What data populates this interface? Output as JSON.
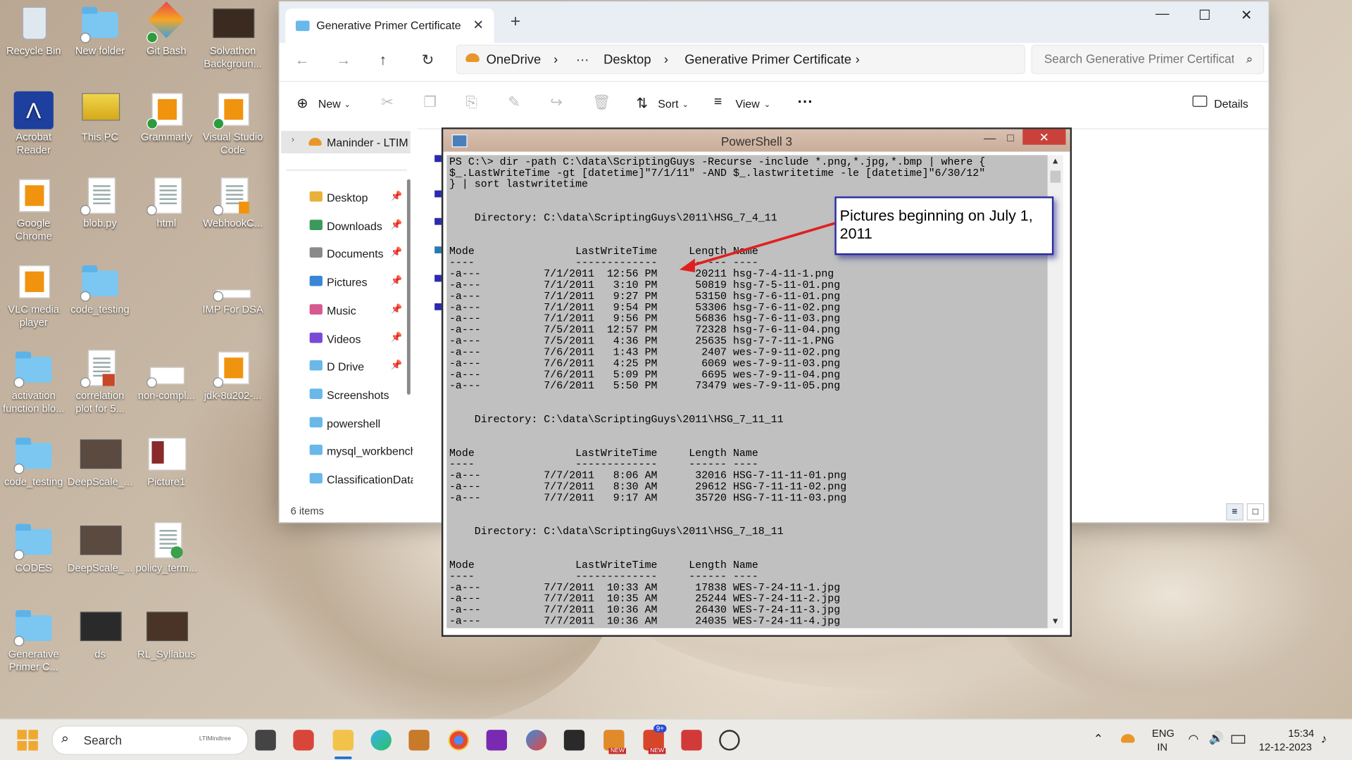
{
  "desktop_icons": [
    {
      "label": "Recycle Bin"
    },
    {
      "label": "New folder"
    },
    {
      "label": "Git Bash"
    },
    {
      "label": "Solvathon Backgroun..."
    },
    {
      "label": "Acrobat Reader"
    },
    {
      "label": "This PC"
    },
    {
      "label": "Grammarly"
    },
    {
      "label": "Visual Studio Code"
    },
    {
      "label": "Google Chrome"
    },
    {
      "label": "blob.py"
    },
    {
      "label": "html"
    },
    {
      "label": "WebhookC..."
    },
    {
      "label": "VLC media player"
    },
    {
      "label": "code_testing"
    },
    {
      "label": "IMP For DSA"
    },
    {
      "label": "activation function blo..."
    },
    {
      "label": "correlation plot for 5..."
    },
    {
      "label": "non-compl..."
    },
    {
      "label": "jdk-8u202-..."
    },
    {
      "label": "code_testing"
    },
    {
      "label": "DeepScale_..."
    },
    {
      "label": "Picture1"
    },
    {
      "label": "CODES"
    },
    {
      "label": "DeepScale_..."
    },
    {
      "label": "policy_term..."
    },
    {
      "label": "Generative Primer C..."
    },
    {
      "label": "ds"
    },
    {
      "label": "RL_Syllabus"
    }
  ],
  "explorer": {
    "tab_title": "Generative Primer Certificate",
    "new_tab_symbol": "+",
    "close_tab_symbol": "✕",
    "window_controls": {
      "minimize": "—",
      "maximize": "☐",
      "close": "✕"
    },
    "breadcrumb": [
      "OneDrive",
      "Desktop",
      "Generative Primer Certificate"
    ],
    "breadcrumb_sep": "›",
    "overflow": "···",
    "search_placeholder": "Search Generative Primer Certificate",
    "toolbar": {
      "new": "New",
      "sort": "Sort",
      "view": "View",
      "more": "···",
      "details": "Details"
    },
    "sidebar_root": "Maninder - LTIM",
    "nav_items": [
      {
        "label": "Desktop",
        "icon": "desktop-icon",
        "color": "#e8b23a",
        "pinned": true
      },
      {
        "label": "Downloads",
        "icon": "download-icon",
        "color": "#3a9a5b",
        "pinned": true
      },
      {
        "label": "Documents",
        "icon": "document-icon",
        "color": "#8a8a8a",
        "pinned": true
      },
      {
        "label": "Pictures",
        "icon": "picture-icon",
        "color": "#3a86d6",
        "pinned": true
      },
      {
        "label": "Music",
        "icon": "music-icon",
        "color": "#d65a8f",
        "pinned": true
      },
      {
        "label": "Videos",
        "icon": "video-icon",
        "color": "#7a4ad6",
        "pinned": true
      },
      {
        "label": "D Drive",
        "icon": "folder-icon",
        "color": "#6ab7ea",
        "pinned": true
      },
      {
        "label": "Screenshots",
        "icon": "folder-icon",
        "color": "#6ab7ea",
        "pinned": false
      },
      {
        "label": "powershell",
        "icon": "folder-icon",
        "color": "#6ab7ea",
        "pinned": false
      },
      {
        "label": "mysql_workbench",
        "icon": "folder-icon",
        "color": "#6ab7ea",
        "pinned": false
      },
      {
        "label": "ClassificationData",
        "icon": "folder-icon",
        "color": "#6ab7ea",
        "pinned": false
      }
    ],
    "status": "6 items"
  },
  "powershell": {
    "title": "PowerShell 3",
    "lines": [
      "PS C:\\> dir -path C:\\data\\ScriptingGuys -Recurse -include *.png,*.jpg,*.bmp | where {",
      "$_.LastWriteTime -gt [datetime]\"7/1/11\" -AND $_.lastwritetime -le [datetime]\"6/30/12\"",
      "} | sort lastwritetime",
      "",
      "",
      "    Directory: C:\\data\\ScriptingGuys\\2011\\HSG_7_4_11",
      "",
      "",
      "Mode                LastWriteTime     Length Name",
      "----                -------------     ------ ----",
      "-a---          7/1/2011  12:56 PM      20211 hsg-7-4-11-1.png",
      "-a---          7/1/2011   3:10 PM      50819 hsg-7-5-11-01.png",
      "-a---          7/1/2011   9:27 PM      53150 hsg-7-6-11-01.png",
      "-a---          7/1/2011   9:54 PM      53306 hsg-7-6-11-02.png",
      "-a---          7/1/2011   9:56 PM      56836 hsg-7-6-11-03.png",
      "-a---          7/5/2011  12:57 PM      72328 hsg-7-6-11-04.png",
      "-a---          7/5/2011   4:36 PM      25635 hsg-7-7-11-1.PNG",
      "-a---          7/6/2011   1:43 PM       2407 wes-7-9-11-02.png",
      "-a---          7/6/2011   4:25 PM       6069 wes-7-9-11-03.png",
      "-a---          7/6/2011   5:09 PM       6695 wes-7-9-11-04.png",
      "-a---          7/6/2011   5:50 PM      73479 wes-7-9-11-05.png",
      "",
      "",
      "    Directory: C:\\data\\ScriptingGuys\\2011\\HSG_7_11_11",
      "",
      "",
      "Mode                LastWriteTime     Length Name",
      "----                -------------     ------ ----",
      "-a---          7/7/2011   8:06 AM      32016 HSG-7-11-11-01.png",
      "-a---          7/7/2011   8:30 AM      29612 HSG-7-11-11-02.png",
      "-a---          7/7/2011   9:17 AM      35720 HSG-7-11-11-03.png",
      "",
      "",
      "    Directory: C:\\data\\ScriptingGuys\\2011\\HSG_7_18_11",
      "",
      "",
      "Mode                LastWriteTime     Length Name",
      "----                -------------     ------ ----",
      "-a---          7/7/2011  10:33 AM      17838 WES-7-24-11-1.jpg",
      "-a---          7/7/2011  10:35 AM      25244 WES-7-24-11-2.jpg",
      "-a---          7/7/2011  10:36 AM      26430 WES-7-24-11-3.jpg",
      "-a---          7/7/2011  10:36 AM      24035 WES-7-24-11-4.jpg"
    ],
    "callout": "Pictures beginning on July 1, 2011",
    "callout_border": "#2a2aa0",
    "arrow_color": "#e02020"
  },
  "taskbar": {
    "search_label": "Search",
    "search_brand": "LTIMindtree",
    "lang": "ENG",
    "region": "IN",
    "time": "15:34",
    "date": "12-12-2023",
    "badge_new": "NEW",
    "badge_count": "9+"
  }
}
